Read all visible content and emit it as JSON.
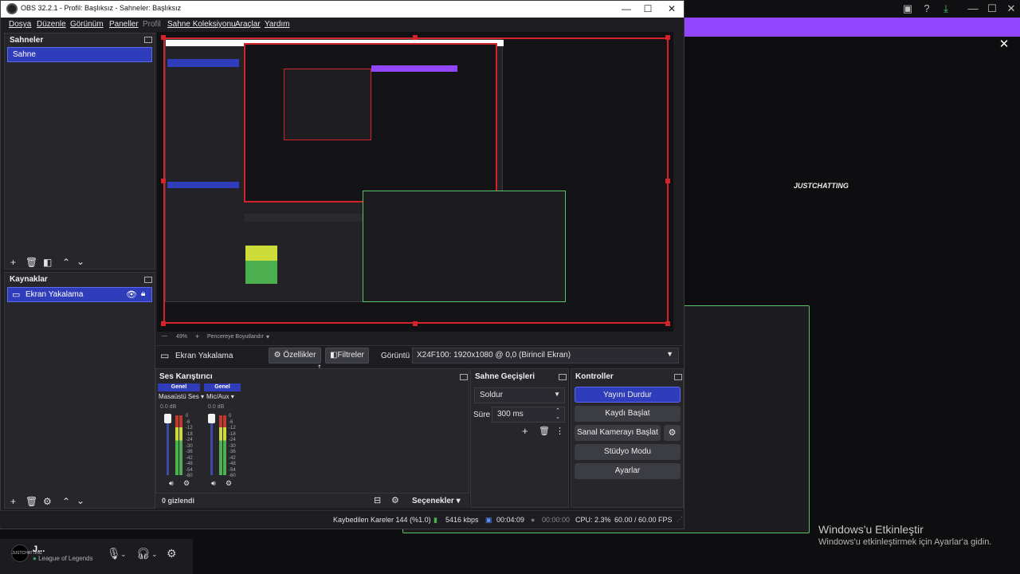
{
  "window": {
    "title": "OBS 32.2.1 - Profil: Başlıksız - Sahneler: Başlıksız",
    "minimize": "—",
    "maximize": "☐",
    "close": "✕"
  },
  "menu": [
    "Dosya",
    "Düzenle",
    "Görünüm",
    "Paneller",
    "Profil",
    "Sahne Koleksiyonu",
    "Araçlar",
    "Yardım"
  ],
  "scenes": {
    "title": "Sahneler",
    "items": [
      "Sahne"
    ]
  },
  "sources": {
    "title": "Kaynaklar",
    "items": [
      "Ekran Yakalama"
    ]
  },
  "preview_bar": {
    "zoom": "49%",
    "fit": "Pencereye Boyutlandır"
  },
  "source_toolbar": {
    "source_name": "Ekran Yakalama",
    "properties": "Özellikler",
    "filters": "Filtreler",
    "display_label": "Görüntü",
    "display_value": "X24F100: 1920x1080 @ 0,0 (Birincil Ekran)"
  },
  "mixer": {
    "title": "Ses Karıştırıcı",
    "channels": [
      {
        "tag": "Genel",
        "name": "Masaüstü Ses",
        "db": "0.0 dB"
      },
      {
        "tag": "Genel",
        "name": "Mic/Aux",
        "db": "0.0 dB"
      }
    ],
    "scale": [
      "0",
      "-6",
      "-12",
      "-18",
      "-24",
      "-30",
      "-36",
      "-42",
      "-48",
      "-54",
      "-60"
    ],
    "hidden": "0 gizlendi",
    "options": "Seçenekler"
  },
  "transitions": {
    "title": "Sahne Geçişleri",
    "type": "Soldur",
    "duration_label": "Süre",
    "duration": "300 ms"
  },
  "controls": {
    "title": "Kontroller",
    "stop_stream": "Yayını Durdur",
    "start_record": "Kaydı Başlat",
    "virtual_cam": "Sanal Kamerayı Başlat",
    "studio": "Stüdyo Modu",
    "settings": "Ayarlar"
  },
  "status": {
    "dropped": "Kaybedilen Kareler 144 (%1.0)",
    "bitrate": "5416 kbps",
    "stream_time": "00:04:09",
    "record_time": "00:00:00",
    "cpu": "CPU: 2.3%",
    "fps": "60.00 / 60.00 FPS"
  },
  "background": {
    "activate_title": "Windows'u Etkinleştir",
    "activate_text": "Windows'u etkinleştirmek için Ayarlar'a gidin.",
    "logo_text": "JUSTCHATTING"
  },
  "footer": {
    "name": "J...",
    "status": "League of Legends",
    "avatar_text": "JUSTCHATTING"
  },
  "colors": {
    "accent": "#2f3dba",
    "brand_purple": "#9147ff",
    "selection_red": "#d4242b",
    "active_green": "#58c26c"
  }
}
